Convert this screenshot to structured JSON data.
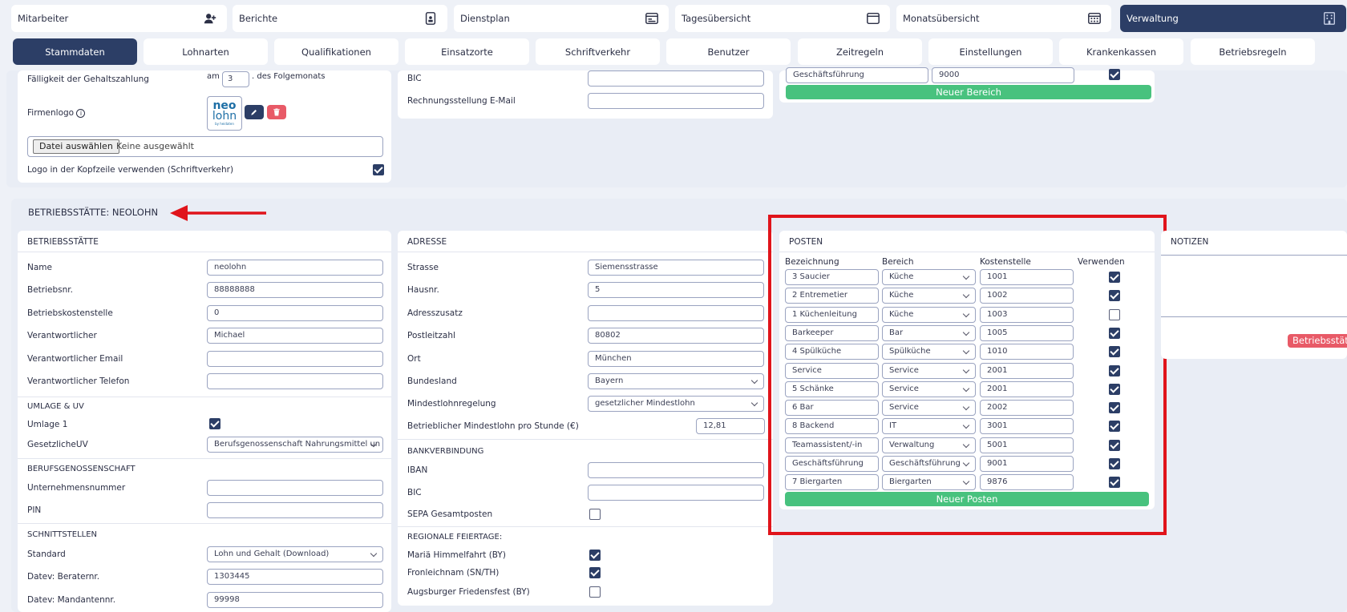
{
  "topnav": [
    {
      "label": "Mitarbeiter",
      "icon": "user-plus-icon"
    },
    {
      "label": "Berichte",
      "icon": "report-icon"
    },
    {
      "label": "Dienstplan",
      "icon": "schedule-icon"
    },
    {
      "label": "Tagesübersicht",
      "icon": "day-window-icon"
    },
    {
      "label": "Monatsübersicht",
      "icon": "calendar-icon"
    },
    {
      "label": "Verwaltung",
      "icon": "building-icon"
    }
  ],
  "subnav": [
    "Stammdaten",
    "Lohnarten",
    "Qualifikationen",
    "Einsatzorte",
    "Schriftverkehr",
    "Benutzer",
    "Zeitregeln",
    "Einstellungen",
    "Krankenkassen",
    "Betriebsregeln"
  ],
  "company": {
    "due_label": "Fälligkeit der Gehaltszahlung",
    "due_prefix": "am",
    "due_value": "3",
    "due_suffix": ". des Folgemonats",
    "logo_label": "Firmenlogo",
    "logo_text_top": "neo",
    "logo_text_bottom": "lohn",
    "logo_text_tiny": "by heidaten",
    "file_button": "Datei auswählen",
    "file_status": "Keine ausgewählt",
    "logo_header_label": "Logo in der Kopfzeile verwenden (Schriftverkehr)",
    "bic_label": "BIC",
    "invoice_email_label": "Rechnungsstellung E-Mail"
  },
  "bereich_top": {
    "name": "Geschäftsführung",
    "cost": "9000",
    "button": "Neuer Bereich"
  },
  "site_title": "BETRIEBSSTÄTTE: NEOLOHN",
  "betriebsstaette": {
    "title": "BETRIEBSSTÄTTE",
    "fields": [
      {
        "label": "Name",
        "value": "neolohn"
      },
      {
        "label": "Betriebsnr.",
        "value": "88888888"
      },
      {
        "label": "Betriebskostenstelle",
        "value": "0"
      },
      {
        "label": "Verantwortlicher",
        "value": "Michael"
      },
      {
        "label": "Verantwortlicher Email",
        "value": ""
      },
      {
        "label": "Verantwortlicher Telefon",
        "value": ""
      }
    ],
    "umlage_title": "UMLAGE & UV",
    "umlage1_label": "Umlage 1",
    "uv_label": "GesetzlicheUV",
    "uv_value": "Berufsgenossenschaft Nahrungsmittel un",
    "bg_title": "BERUFSGENOSSENSCHAFT",
    "un_label": "Unternehmensnummer",
    "pin_label": "PIN",
    "if_title": "SCHNITTSTELLEN",
    "std_label": "Standard",
    "std_value": "Lohn und Gehalt (Download)",
    "berater_label": "Datev: Beraternr.",
    "berater_value": "1303445",
    "mandant_label": "Datev: Mandantennr.",
    "mandant_value": "99998"
  },
  "adresse": {
    "title": "ADRESSE",
    "fields": [
      {
        "label": "Strasse",
        "value": "Siemensstrasse"
      },
      {
        "label": "Hausnr.",
        "value": "5"
      },
      {
        "label": "Adresszusatz",
        "value": ""
      },
      {
        "label": "Postleitzahl",
        "value": "80802"
      },
      {
        "label": "Ort",
        "value": "München"
      }
    ],
    "bundesland_label": "Bundesland",
    "bundesland_value": "Bayern",
    "mlr_label": "Mindestlohnregelung",
    "mlr_value": "gesetzlicher Mindestlohn",
    "bml_label": "Betrieblicher Mindestlohn pro Stunde (€)",
    "bml_value": "12,81",
    "bank_title": "BANKVERBINDUNG",
    "iban_label": "IBAN",
    "bic_label": "BIC",
    "sepa_label": "SEPA Gesamtposten",
    "holiday_title": "REGIONALE FEIERTAGE:",
    "holidays": [
      {
        "label": "Mariä Himmelfahrt (BY)",
        "checked": true
      },
      {
        "label": "Fronleichnam (SN/TH)",
        "checked": true
      },
      {
        "label": "Augsburger Friedensfest (BY)",
        "checked": false
      }
    ]
  },
  "posten": {
    "title": "POSTEN",
    "headers": [
      "Bezeichnung",
      "Bereich",
      "Kostenstelle",
      "Verwenden"
    ],
    "rows": [
      {
        "name": "3 Saucier",
        "bereich": "Küche",
        "cost": "1001",
        "use": true
      },
      {
        "name": "2 Entremetier",
        "bereich": "Küche",
        "cost": "1002",
        "use": true
      },
      {
        "name": "1 Küchenleitung",
        "bereich": "Küche",
        "cost": "1003",
        "use": false
      },
      {
        "name": "Barkeeper",
        "bereich": "Bar",
        "cost": "1005",
        "use": true
      },
      {
        "name": "4 Spülküche",
        "bereich": "Spülküche",
        "cost": "1010",
        "use": true
      },
      {
        "name": "Service",
        "bereich": "Service",
        "cost": "2001",
        "use": true
      },
      {
        "name": "5 Schänke",
        "bereich": "Service",
        "cost": "2001",
        "use": true
      },
      {
        "name": "6 Bar",
        "bereich": "Service",
        "cost": "2002",
        "use": true
      },
      {
        "name": "8 Backend",
        "bereich": "IT",
        "cost": "3001",
        "use": true
      },
      {
        "name": "Teamassistent/-in",
        "bereich": "Verwaltung",
        "cost": "5001",
        "use": true
      },
      {
        "name": "Geschäftsführung",
        "bereich": "Geschäftsführung",
        "cost": "9001",
        "use": true
      },
      {
        "name": "7 Biergarten",
        "bereich": "Biergarten",
        "cost": "9876",
        "use": true
      }
    ],
    "button": "Neuer Posten"
  },
  "notizen": {
    "title": "NOTIZEN",
    "badge": "Betriebsstätt"
  },
  "colors": {
    "navy": "#2c3e66",
    "green": "#48c27e",
    "red_highlight": "#e0141b",
    "badge_red": "#e85a67"
  }
}
